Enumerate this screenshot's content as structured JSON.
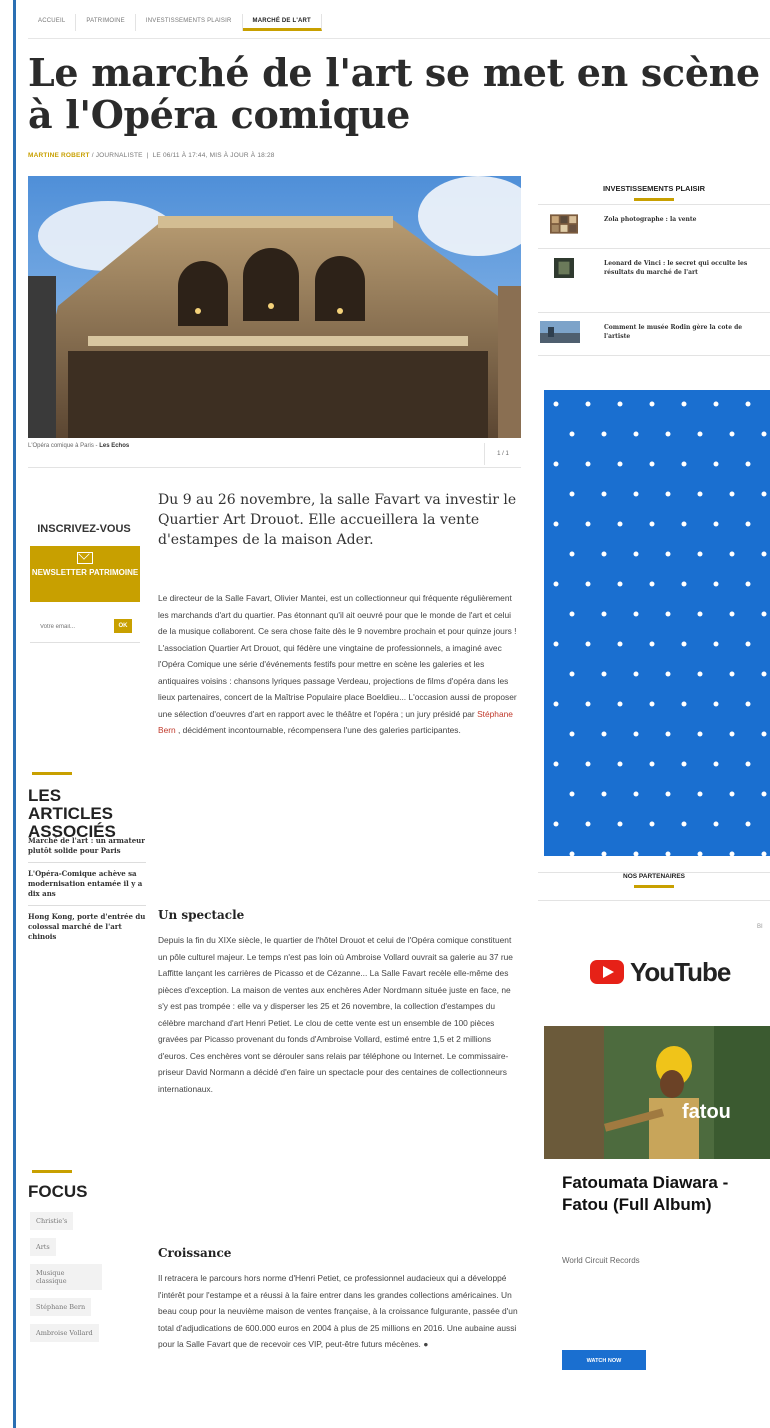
{
  "breadcrumb": [
    "ACCUEIL",
    "PATRIMOINE",
    "INVESTISSEMENTS PLAISIR",
    "MARCHÉ DE L'ART"
  ],
  "article": {
    "title": "Le marché de l'art se met en scène à l'Opéra comique",
    "author": "MARTINE ROBERT",
    "role": "/ JOURNALISTE",
    "date": "LE 06/11 À 17:44, MIS À JOUR À 18:28",
    "caption": "L'Opéra comique à Paris - ",
    "caption_credit": "Les Echos",
    "counter": "1 / 1",
    "chapo": "Du 9 au 26 novembre, la salle Favart va investir le Quartier Art Drouot. Elle accueillera la vente d'estampes de la maison Ader.",
    "p1a": "Le directeur de la Salle Favart, Olivier Mantei, est un collectionneur qui fréquente régulièrement les marchands d'art du quartier. Pas étonnant qu'il ait oeuvré pour que le monde de l'art et celui de la musique collaborent. Ce sera chose faite dès le 9 novembre prochain et pour quinze jours ! L'association Quartier Art Drouot, qui fédère une vingtaine de professionnels, a imaginé avec l'Opéra Comique une série d'événements festifs pour mettre en scène les galeries et les antiquaires voisins : chansons lyriques passage Verdeau, projections de films d'opéra dans les lieux partenaires, concert de la Maîtrise Populaire place Boeldieu... L'occasion aussi de proposer une sélection d'oeuvres d'art en rapport avec le théâtre et l'opéra ; un jury présidé par ",
    "p1link": "Stéphane Bern",
    "p1b": " , décidément incontournable, récompensera l'une des galeries participantes.",
    "h2a": "Un spectacle",
    "p2": "Depuis la fin du XIXe siècle, le quartier de l'hôtel Drouot et celui de l'Opéra comique constituent un pôle culturel majeur. Le temps n'est pas loin où Ambroise Vollard ouvrait sa galerie au 37 rue Laffitte lançant les carrières de Picasso et de Cézanne... La Salle Favart recèle elle-même des pièces d'exception. La maison de ventes aux enchères Ader Nordmann située juste en face, ne s'y est pas trompée : elle va y disperser les 25 et 26 novembre, la collection d'estampes du célèbre marchand d'art Henri Petiet. Le clou de cette vente est un ensemble de 100 pièces gravées par Picasso provenant du fonds d'Ambroise Vollard, estimé entre 1,5 et 2 millions d'euros. Ces enchères vont se dérouler sans relais par téléphone ou Internet. Le commissaire-priseur David Normann a décidé d'en faire un spectacle pour des centaines de collectionneurs internationaux.",
    "h2b": "Croissance",
    "p3": "Il retracera le parcours hors norme d'Henri Petiet, ce professionnel audacieux qui a développé l'intérêt pour l'estampe et a réussi à la faire entrer dans les grandes collections américaines. Un beau coup pour la neuvième maison de ventes française, à la croissance fulgurante, passée d'un total d'adjudications de 600.000 euros en 2004 à plus de 25 millions en 2016. Une aubaine aussi pour la Salle Favart que de recevoir ces VIP, peut-être futurs mécènes. ●"
  },
  "newsletter": {
    "heading": "INSCRIVEZ-VOUS",
    "label": "NEWSLETTER PATRIMOINE",
    "placeholder": "Votre email...",
    "ok": "OK"
  },
  "related": {
    "heading": "LES ARTICLES ASSOCIÉS",
    "items": [
      "Marché de l'art : un armateur plutôt solide pour Paris",
      "L'Opéra-Comique achève sa modernisation entamée il y a dix ans",
      "Hong Kong, porte d'entrée du colossal marché de l'art chinois"
    ]
  },
  "focus": {
    "heading": "FOCUS",
    "tags": [
      "Christie's",
      "Arts",
      "Musique classique",
      "Stéphane Bern",
      "Ambroise Vollard"
    ]
  },
  "sidebar": {
    "heading": "INVESTISSEMENTS PLAISIR",
    "items": [
      "Zola photographe : la vente",
      "Leonard de Vinci : le secret qui occulte les résultats du marché de l'art",
      "Comment le musée Rodin gère la cote de l'artiste"
    ],
    "partners_heading": "NOS PARTENAIRES",
    "mini": "BI",
    "youtube": "YouTube",
    "album_title": "Fatoumata Diawara - Fatou (Full Album)",
    "album_label": "World Circuit Records",
    "album_art_text": "fatou",
    "watch": "WATCH NOW"
  },
  "colors": {
    "accent": "#c8a000",
    "link": "#c0392b",
    "ad_blue": "#1a6fd0"
  }
}
